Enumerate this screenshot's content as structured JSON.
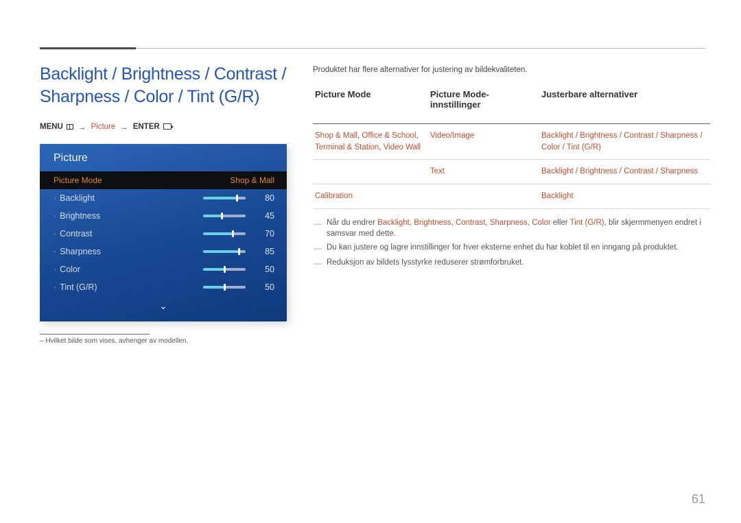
{
  "heading": "Backlight / Brightness / Contrast / Sharpness / Color / Tint (G/R)",
  "menu_path": {
    "menu": "MENU",
    "picture": "Picture",
    "enter": "ENTER"
  },
  "osd": {
    "title": "Picture",
    "selected": {
      "label": "Picture Mode",
      "value": "Shop & Mall"
    },
    "rows": [
      {
        "label": "Backlight",
        "value": 80
      },
      {
        "label": "Brightness",
        "value": 45
      },
      {
        "label": "Contrast",
        "value": 70
      },
      {
        "label": "Sharpness",
        "value": 85
      },
      {
        "label": "Color",
        "value": 50
      },
      {
        "label": "Tint (G/R)",
        "value": 50
      }
    ]
  },
  "footnote": "– Hvilket bilde som vises, avhenger av modellen.",
  "intro": "Produktet har flere alternativer for justering av bildekvaliteten.",
  "table": {
    "headers": [
      "Picture Mode",
      "Picture Mode-innstillinger",
      "Justerbare alternativer"
    ],
    "rows": [
      {
        "c1": "Shop & Mall, Office & School, Terminal & Station, Video Wall",
        "c2": "Video/Image",
        "c3": "Backlight / Brightness / Contrast / Sharpness / Color / Tint (G/R)"
      },
      {
        "c1": "",
        "c2": "Text",
        "c3": "Backlight / Brightness / Contrast / Sharpness"
      },
      {
        "c1": "Calibration",
        "c2": "",
        "c3": "Backlight"
      }
    ]
  },
  "notes": {
    "n1_pre": "Når du endrer ",
    "n1_terms": [
      "Backlight",
      "Brightness",
      "Contrast",
      "Sharpness",
      "Color"
    ],
    "n1_mid": " eller ",
    "n1_last": "Tint (G/R)",
    "n1_post": ", blir skjermmenyen endret i samsvar med dette.",
    "n2": "Du kan justere og lagre innstillinger for hver eksterne enhet du har koblet til en inngang på produktet.",
    "n3": "Reduksjon av bildets lysstyrke reduserer strømforbruket."
  },
  "page_number": "61"
}
